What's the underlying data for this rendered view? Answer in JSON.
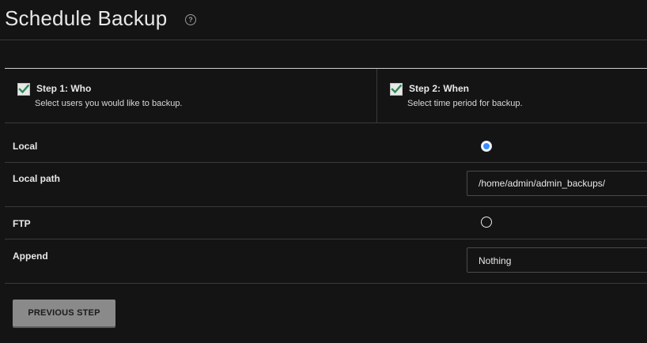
{
  "header": {
    "title": "Schedule Backup",
    "help_icon": "question-circle-icon",
    "help_glyph": "?"
  },
  "steps": [
    {
      "title": "Step 1: Who",
      "description": "Select users you would like to backup.",
      "checked": true
    },
    {
      "title": "Step 2: When",
      "description": "Select time period for backup.",
      "checked": true
    }
  ],
  "form": {
    "local": {
      "label": "Local",
      "selected": true
    },
    "local_path": {
      "label": "Local path",
      "value": "/home/admin/admin_backups/"
    },
    "ftp": {
      "label": "FTP",
      "selected": false
    },
    "append": {
      "label": "Append",
      "value": "Nothing"
    }
  },
  "actions": {
    "previous_label": "PREVIOUS STEP"
  },
  "colors": {
    "background": "#141414",
    "check_green": "#2e8b57",
    "radio_blue": "#3d8bfd",
    "button_gray": "#8a8a8a"
  }
}
